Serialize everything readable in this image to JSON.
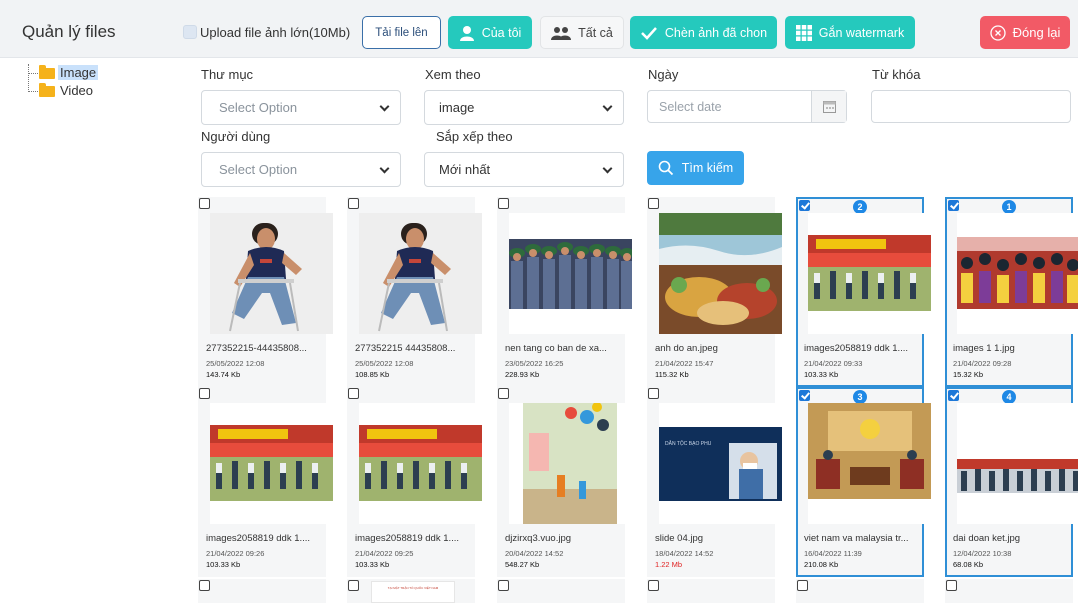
{
  "header": {
    "title": "Quản lý files",
    "upload_large_label": "Upload file ảnh lớn(10Mb)",
    "upload_button": "Tải file lên",
    "mine_button": "Của tôi",
    "all_button": "Tất cả",
    "insert_button": "Chèn ảnh đã chon",
    "watermark_button": "Gắn watermark",
    "close_button": "Đóng lại"
  },
  "tree": {
    "items": [
      {
        "label": "Image",
        "selected": true
      },
      {
        "label": "Video",
        "selected": false
      }
    ]
  },
  "filters": {
    "folder_label": "Thư mục",
    "folder_placeholder": "Select Option",
    "view_label": "Xem theo",
    "view_value": "image",
    "date_label": "Ngày",
    "date_placeholder": "Select date",
    "keyword_label": "Từ khóa",
    "user_label": "Người dùng",
    "user_placeholder": "Select Option",
    "sort_label": "Sắp xếp theo",
    "sort_value": "Mới nhất",
    "search_button": "Tìm kiếm"
  },
  "files": [
    {
      "name": "277352215-44435808...",
      "date": "25/05/2022 12:08",
      "size": "143.74 Kb",
      "checked": false,
      "order": "",
      "thumb": "girl"
    },
    {
      "name": "277352215 44435808...",
      "date": "25/05/2022 12:08",
      "size": "108.85 Kb",
      "checked": false,
      "order": "",
      "thumb": "girl"
    },
    {
      "name": "nen tang co ban de xa...",
      "date": "23/05/2022 16:25",
      "size": "228.93 Kb",
      "checked": false,
      "order": "",
      "thumb": "soldiers"
    },
    {
      "name": "anh do an.jpeg",
      "date": "21/04/2022 15:47",
      "size": "115.32 Kb",
      "checked": false,
      "order": "",
      "thumb": "food"
    },
    {
      "name": "images2058819 ddk 1....",
      "date": "21/04/2022 09:33",
      "size": "103.33 Kb",
      "checked": true,
      "order": "2",
      "thumb": "dance"
    },
    {
      "name": "images 1 1.jpg",
      "date": "21/04/2022 09:28",
      "size": "15.32 Kb",
      "checked": true,
      "order": "1",
      "thumb": "crowd"
    },
    {
      "name": "images2058819 ddk 1....",
      "date": "21/04/2022 09:26",
      "size": "103.33 Kb",
      "checked": false,
      "order": "",
      "thumb": "dance"
    },
    {
      "name": "images2058819 ddk 1....",
      "date": "21/04/2022 09:25",
      "size": "103.33 Kb",
      "checked": false,
      "order": "",
      "thumb": "dance"
    },
    {
      "name": "djzirxq3.vuo.jpg",
      "date": "20/04/2022 14:52",
      "size": "548.27 Kb",
      "checked": false,
      "order": "",
      "thumb": "classroom"
    },
    {
      "name": "slide 04.jpg",
      "date": "18/04/2022 14:52",
      "size": "1.22 Mb",
      "checked": false,
      "order": "",
      "thumb": "slide",
      "size_red": true
    },
    {
      "name": "viet nam va malaysia tr...",
      "date": "16/04/2022 11:39",
      "size": "210.08 Kb",
      "checked": true,
      "order": "3",
      "thumb": "meeting"
    },
    {
      "name": "dai doan ket.jpg",
      "date": "12/04/2022 10:38",
      "size": "68.08 Kb",
      "checked": true,
      "order": "4",
      "thumb": "dance2"
    }
  ],
  "partial_row": {
    "banner_text": "TẠI MẶT TRẬN TỔ QUỐC VIỆT NAM"
  }
}
